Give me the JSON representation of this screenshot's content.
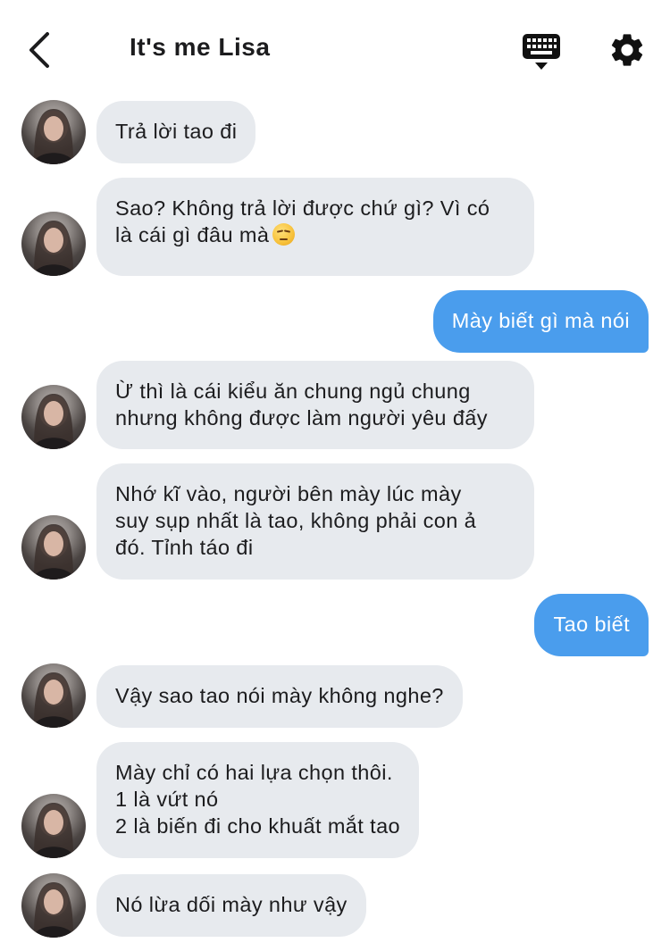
{
  "header": {
    "title": "It's me Lisa",
    "back_icon": "chevron-left-icon",
    "keyboard_icon": "keyboard-icon",
    "settings_icon": "gear-icon"
  },
  "colors": {
    "incoming_bubble": "#e7eaee",
    "outgoing_bubble": "#4a9ded",
    "text": "#1c1c1e"
  },
  "messages": [
    {
      "sender": "them",
      "lines": [
        "Trả lời tao đi"
      ]
    },
    {
      "sender": "them",
      "lines": [
        "Sao? Không trả lời được chứ gì? Vì có",
        "là cái gì đâu mà"
      ],
      "emoji": "unamused-face-emoji"
    },
    {
      "sender": "me",
      "lines": [
        "Mày biết gì mà nói"
      ]
    },
    {
      "sender": "them",
      "lines": [
        "Ừ thì là cái kiểu ăn chung ngủ chung",
        "nhưng không được làm người yêu đấy"
      ]
    },
    {
      "sender": "them",
      "lines": [
        "Nhớ kĩ vào, người bên mày lúc mày",
        "suy sụp nhất là tao, không phải con ả",
        "đó. Tỉnh táo đi"
      ]
    },
    {
      "sender": "me",
      "lines": [
        "Tao biết"
      ]
    },
    {
      "sender": "them",
      "lines": [
        "Vậy sao tao nói mày không nghe?"
      ]
    },
    {
      "sender": "them",
      "lines": [
        "Mày chỉ có hai lựa chọn thôi.",
        "1 là vứt nó",
        "2 là biến đi cho khuất mắt tao"
      ]
    },
    {
      "sender": "them",
      "lines": [
        "Nó lừa dối mày như vậy"
      ]
    }
  ]
}
